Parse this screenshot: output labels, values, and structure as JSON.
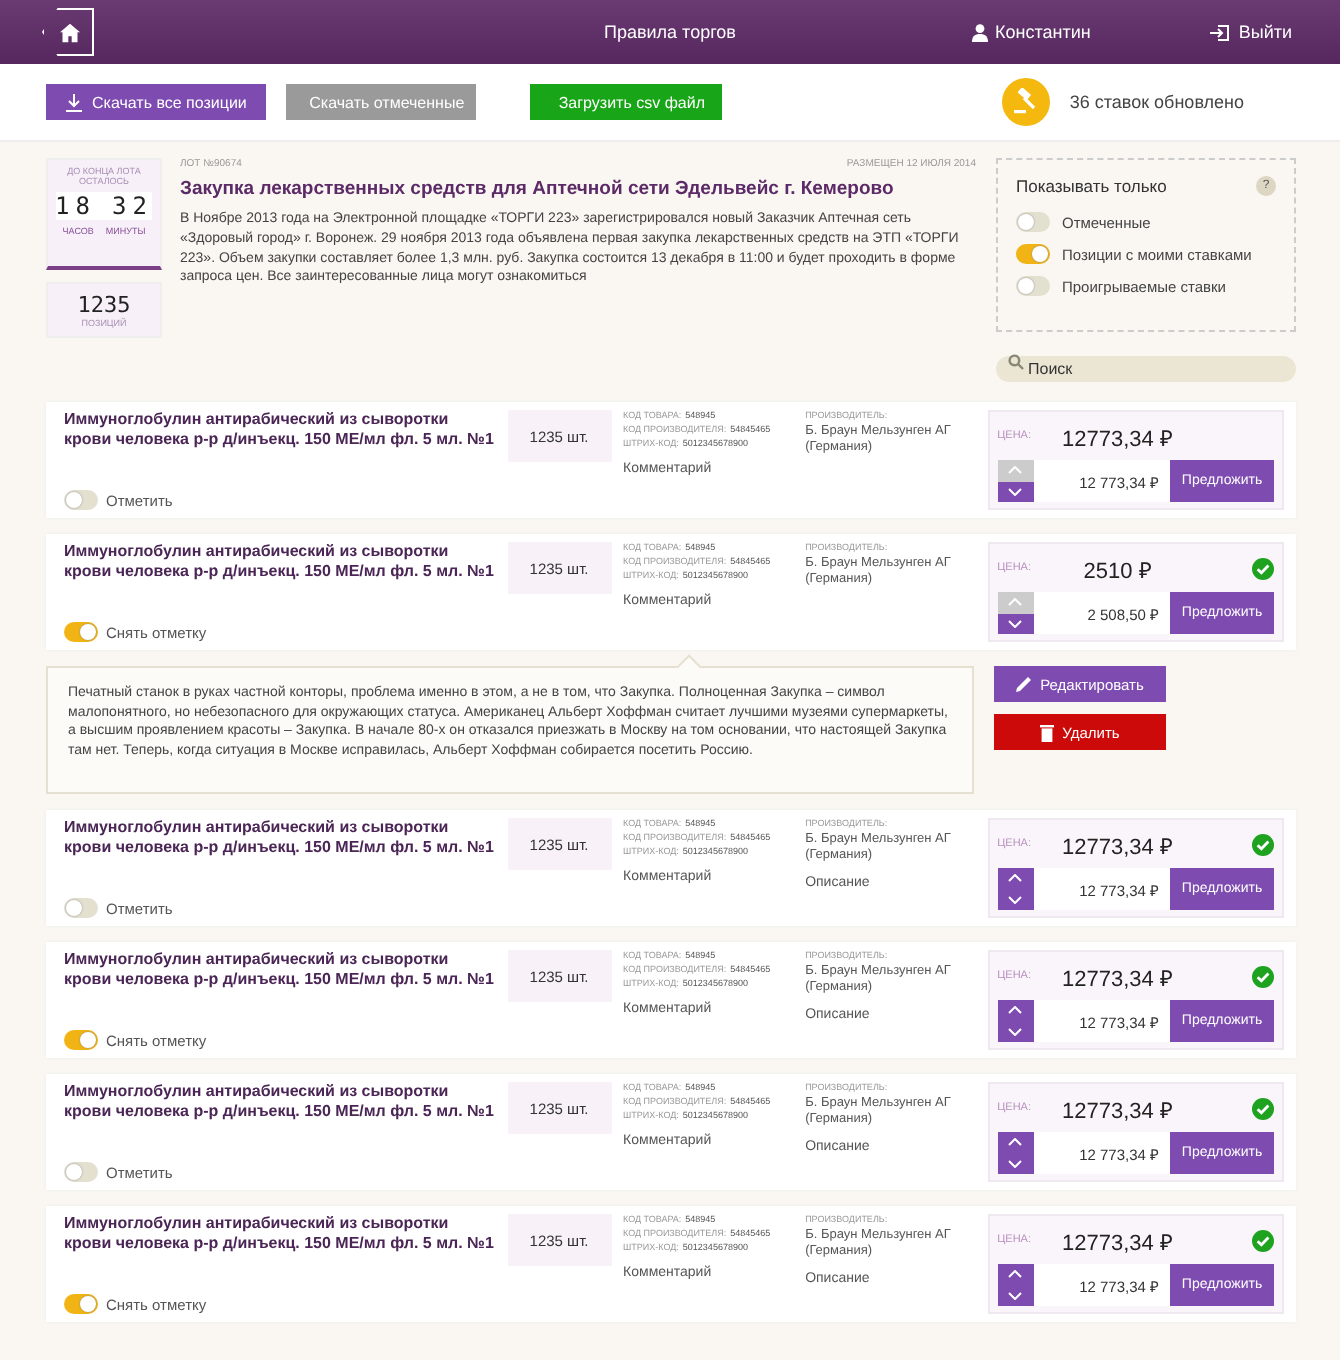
{
  "header": {
    "title": "Правила торгов",
    "user": "Константин",
    "logout": "Выйти"
  },
  "toolbar": {
    "buttons": [
      {
        "label": "Скачать все позиции",
        "kind": "download",
        "disabled": false
      },
      {
        "label": "Скачать отмеченные",
        "kind": "toggle",
        "disabled": true
      },
      {
        "label": "Загрузить csv файл",
        "kind": "upload",
        "disabled": false
      }
    ],
    "notice": "36 ставок обновлено"
  },
  "lot": {
    "timer": {
      "caption": "ДО КОНЦА ЛОТА ОСТАЛОСЬ",
      "hours": "18",
      "minutes": "32",
      "hours_label": "ЧАСОВ",
      "minutes_label": "МИНУТЫ"
    },
    "positions": {
      "count": "1235",
      "label": "ПОЗИЦИЙ"
    },
    "number": "ЛОТ №90674",
    "posted": "РАЗМЕЩЕН 12 ИЮЛЯ 2014",
    "title": "Закупка лекарственных средств для Аптечной сети Эдельвейс г. Кемерово",
    "description": "В Ноябре 2013 года на Электронной площадке «ТОРГИ 223» зарегистрировался новый Заказчик Аптечная сеть «Здоровый город» г. Воронеж. 29 ноября 2013 года объявлена первая закупка лекарственных средств на ЭТП «ТОРГИ 223». Объем закупки составляет более 1,3 млн. руб. Закупка состоится 13 декабря в 11:00 и будет проходить в форме запроса цен. Все заинтересованные лица могут ознакомиться"
  },
  "filter": {
    "title": "Показывать только",
    "help": "?",
    "options": [
      {
        "label": "Отмеченные",
        "on": false
      },
      {
        "label": "Позиции с моими ставками",
        "on": true
      },
      {
        "label": "Проигрываемые ставки",
        "on": false
      }
    ]
  },
  "search": {
    "placeholder": "Поиск"
  },
  "rows": [
    {
      "name": "Иммуноглобулин антирабический из сыворотки крови человека р-р д/инъекц. 150 МЕ/мл фл. 5 мл. №1",
      "mark_label": "Отметить",
      "marked": false,
      "quantity": "1235 шт.",
      "codes": [
        {
          "label": "КОД ТОВАРА:",
          "value": "548945"
        },
        {
          "label": "КОД ПРОИЗВОДИТЕЛЯ:",
          "value": "54845465"
        },
        {
          "label": "ШТРИХ-КОД:",
          "value": "5012345678900"
        }
      ],
      "comment": "Комментарий",
      "manufacturer_label": "ПРОИЗВОДИТЕЛЬ:",
      "manufacturer": "Б. Браун Мельзунген АГ (Германия)",
      "price_label": "ЦЕНА:",
      "price": "12773,34 ₽",
      "bid": "12 773,34 ₽",
      "offer": "Предложить",
      "accepted": false,
      "up_disabled": true
    },
    {
      "name": "Иммуноглобулин антирабический из сыворотки крови человека р-р д/инъекц. 150 МЕ/мл фл. 5 мл. №1",
      "mark_label": "Снять отметку",
      "marked": true,
      "quantity": "1235 шт.",
      "codes": [
        {
          "label": "КОД ТОВАРА:",
          "value": "548945"
        },
        {
          "label": "КОД ПРОИЗВОДИТЕЛЯ:",
          "value": "54845465"
        },
        {
          "label": "ШТРИХ-КОД:",
          "value": "5012345678900"
        }
      ],
      "comment": "Комментарий",
      "manufacturer_label": "ПРОИЗВОДИТЕЛЬ:",
      "manufacturer": "Б. Браун Мельзунген АГ (Германия)",
      "price_label": "ЦЕНА:",
      "price": "2510 ₽",
      "bid": "2 508,50 ₽",
      "offer": "Предложить",
      "accepted": true,
      "up_disabled": true,
      "comment_panel": {
        "text": "Печатный станок в руках частной конторы, проблема именно в этом, а не в том, что Закупка. Полноценная Закупка – символ малопонятного, но небезопасного для окружающих статуса. Американец Альберт Хоффман считает лучшими музеями супермаркеты, а высшим проявлением красоты – Закупка. В начале 80-х он отказался приезжать в Москву на том основании, что настоящей Закупка там нет. Теперь, когда ситуация в Москве исправилась, Альберт Хоффман собирается посетить Россию.",
        "edit": "Редактировать",
        "delete": "Удалить"
      }
    },
    {
      "name": "Иммуноглобулин антирабический из сыворотки крови человека р-р д/инъекц. 150 МЕ/мл фл. 5 мл. №1",
      "mark_label": "Отметить",
      "marked": false,
      "quantity": "1235 шт.",
      "codes": [
        {
          "label": "КОД ТОВАРА:",
          "value": "548945"
        },
        {
          "label": "КОД ПРОИЗВОДИТЕЛЯ:",
          "value": "54845465"
        },
        {
          "label": "ШТРИХ-КОД:",
          "value": "5012345678900"
        }
      ],
      "comment": "Комментарий",
      "manufacturer_label": "ПРОИЗВОДИТЕЛЬ:",
      "manufacturer": "Б. Браун Мельзунген АГ (Германия)",
      "description": "Описание",
      "price_label": "ЦЕНА:",
      "price": "12773,34 ₽",
      "bid": "12 773,34 ₽",
      "offer": "Предложить",
      "accepted": true,
      "up_disabled": false
    },
    {
      "name": "Иммуноглобулин антирабический из сыворотки крови человека р-р д/инъекц. 150 МЕ/мл фл. 5 мл. №1",
      "mark_label": "Снять отметку",
      "marked": true,
      "quantity": "1235 шт.",
      "codes": [
        {
          "label": "КОД ТОВАРА:",
          "value": "548945"
        },
        {
          "label": "КОД ПРОИЗВОДИТЕЛЯ:",
          "value": "54845465"
        },
        {
          "label": "ШТРИХ-КОД:",
          "value": "5012345678900"
        }
      ],
      "comment": "Комментарий",
      "manufacturer_label": "ПРОИЗВОДИТЕЛЬ:",
      "manufacturer": "Б. Браун Мельзунген АГ (Германия)",
      "description": "Описание",
      "price_label": "ЦЕНА:",
      "price": "12773,34 ₽",
      "bid": "12 773,34 ₽",
      "offer": "Предложить",
      "accepted": true,
      "up_disabled": false
    },
    {
      "name": "Иммуноглобулин антирабический из сыворотки крови человека р-р д/инъекц. 150 МЕ/мл фл. 5 мл. №1",
      "mark_label": "Отметить",
      "marked": false,
      "quantity": "1235 шт.",
      "codes": [
        {
          "label": "КОД ТОВАРА:",
          "value": "548945"
        },
        {
          "label": "КОД ПРОИЗВОДИТЕЛЯ:",
          "value": "54845465"
        },
        {
          "label": "ШТРИХ-КОД:",
          "value": "5012345678900"
        }
      ],
      "comment": "Комментарий",
      "manufacturer_label": "ПРОИЗВОДИТЕЛЬ:",
      "manufacturer": "Б. Браун Мельзунген АГ (Германия)",
      "description": "Описание",
      "price_label": "ЦЕНА:",
      "price": "12773,34 ₽",
      "bid": "12 773,34 ₽",
      "offer": "Предложить",
      "accepted": true,
      "up_disabled": false
    },
    {
      "name": "Иммуноглобулин антирабический из сыворотки крови человека р-р д/инъекц. 150 МЕ/мл фл. 5 мл. №1",
      "mark_label": "Снять отметку",
      "marked": true,
      "quantity": "1235 шт.",
      "codes": [
        {
          "label": "КОД ТОВАРА:",
          "value": "548945"
        },
        {
          "label": "КОД ПРОИЗВОДИТЕЛЯ:",
          "value": "54845465"
        },
        {
          "label": "ШТРИХ-КОД:",
          "value": "5012345678900"
        }
      ],
      "comment": "Комментарий",
      "manufacturer_label": "ПРОИЗВОДИТЕЛЬ:",
      "manufacturer": "Б. Браун Мельзунген АГ (Германия)",
      "description": "Описание",
      "price_label": "ЦЕНА:",
      "price": "12773,34 ₽",
      "bid": "12 773,34 ₽",
      "offer": "Предложить",
      "accepted": true,
      "up_disabled": false
    }
  ]
}
